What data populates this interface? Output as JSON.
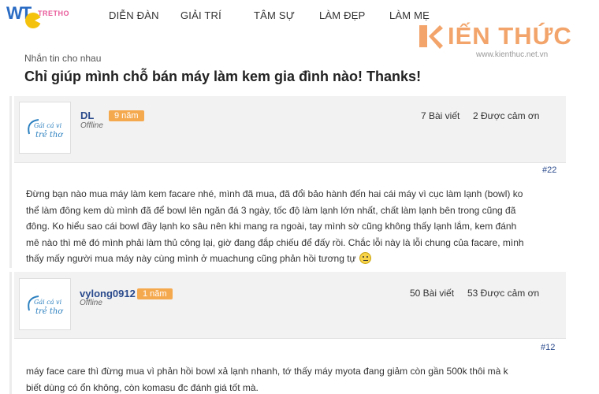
{
  "header": {
    "logo_text": "WT",
    "logo_sub": "TRETHO",
    "nav": [
      "DIỄN ĐÀN",
      "GIẢI TRÍ",
      "TÂM SỰ",
      "LÀM ĐẸP",
      "LÀM MẸ"
    ]
  },
  "watermark": {
    "text": "IẾN THỨC",
    "url": "www.kienthuc.net.vn"
  },
  "breadcrumb": "Nhắn tin cho nhau",
  "title": "Chỉ giúp mình chỗ bán máy làm kem gia đình nào! Thanks!",
  "posts": [
    {
      "username": "DL",
      "status": "Offline",
      "badge": "9 năm",
      "posts_count": "7 Bài viết",
      "thanks": "2 Được cảm ơn",
      "number": "#22",
      "avatar_text": [
        "Gái cá vi",
        "trẻ thơ"
      ],
      "lines": [
        "Đừng bạn nào mua máy làm kem facare nhé, mình đã mua, đã đổi bảo hành đến hai cái máy vì cục làm lạnh (bowl) ko",
        "thể làm đông kem dù mình đã để bowl lên ngăn đá 3 ngày, tốc độ làm lạnh lớn nhất, chất làm lạnh bên trong cũng đã",
        "đông. Ko hiểu sao cái bowl đầy lạnh ko sâu nên khi mang ra ngoài, tay mình sờ cũng không thấy lạnh lắm, kem đánh",
        "mê nào thì mê đó mình phải làm thủ công lại, giờ đang đắp chiếu để đấy rồi. Chắc lỗi này là lỗi chung của facare, mình",
        "thấy mấy người mua máy này cùng mình ở muachung cũng phản hồi tương tự"
      ]
    },
    {
      "username": "vylong0912",
      "status": "Offline",
      "badge": "1 năm",
      "posts_count": "50 Bài viết",
      "thanks": "53 Được cảm ơn",
      "number": "#12",
      "avatar_text": [
        "Gái cá vi",
        "trẻ thơ"
      ],
      "lines": [
        "máy face care thì đừng mua vì phản hồi bowl xả lạnh nhanh, tớ thấy máy myota đang giảm còn gần 500k thôi mà k",
        "biết dùng có ổn không, còn komasu đc đánh giá tốt mà."
      ]
    }
  ],
  "colors": {
    "badge": "#f5a94f",
    "username": "#2a4a8c",
    "header_bg": "#f2f2f2"
  }
}
